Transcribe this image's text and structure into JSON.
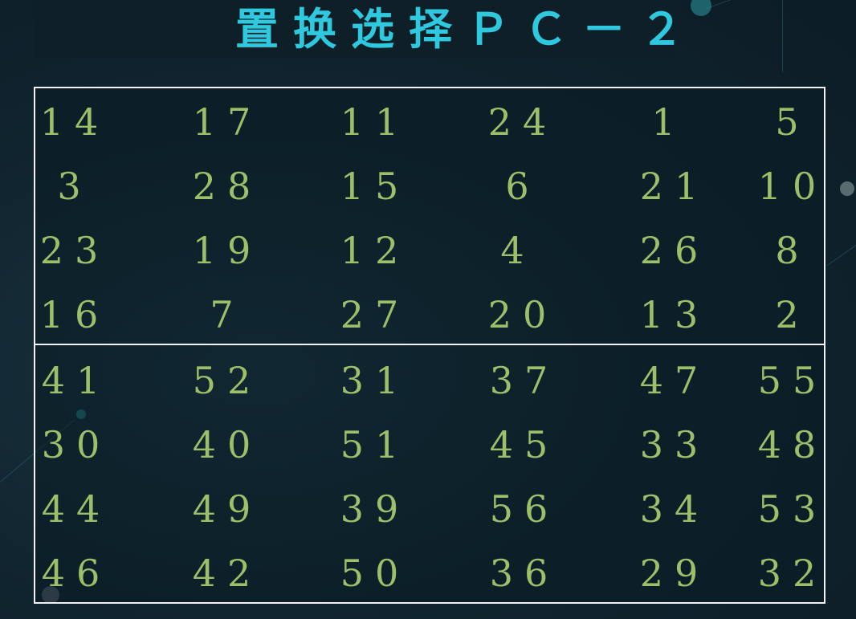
{
  "title": "置换选择ＰＣ－２",
  "colors": {
    "title": "#2ec8df",
    "numbers": "#9cc06a",
    "border": "#f2f2f2"
  },
  "table": {
    "top_rows": [
      [
        "14",
        "17",
        "11",
        "24",
        "1",
        "5"
      ],
      [
        "3",
        "28",
        "15",
        "6",
        "21",
        "10"
      ],
      [
        "23",
        "19",
        "12",
        "4",
        "26",
        "8"
      ],
      [
        "16",
        "7",
        "27",
        "20",
        "13",
        "2"
      ]
    ],
    "bottom_rows": [
      [
        "41",
        "52",
        "31",
        "37",
        "47",
        "55"
      ],
      [
        "30",
        "40",
        "51",
        "45",
        "33",
        "48"
      ],
      [
        "44",
        "49",
        "39",
        "56",
        "34",
        "53"
      ],
      [
        "46",
        "42",
        "50",
        "36",
        "29",
        "32"
      ]
    ]
  }
}
